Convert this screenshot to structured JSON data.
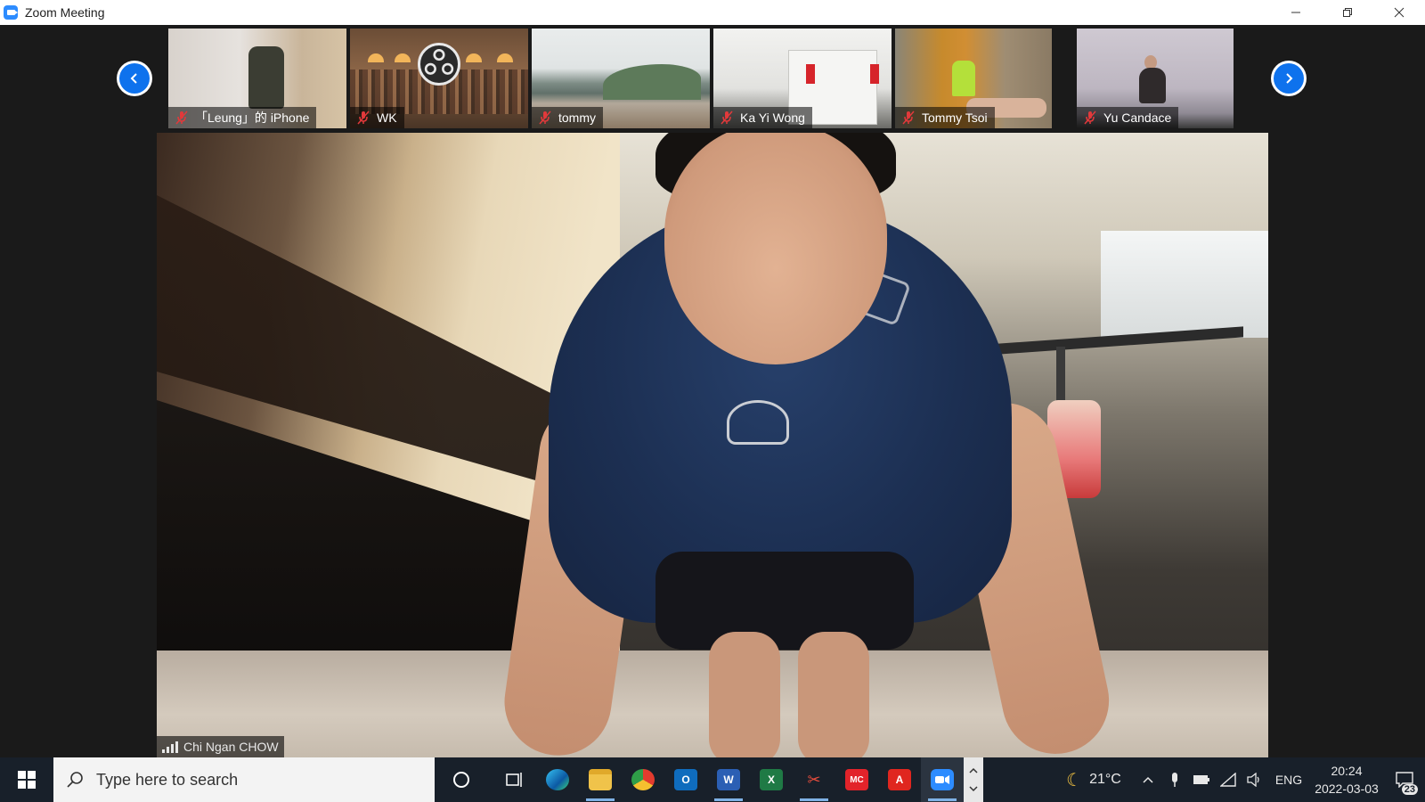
{
  "window": {
    "title": "Zoom Meeting"
  },
  "gallery": {
    "participants": [
      {
        "name": "「Leung」的 iPhone"
      },
      {
        "name": "WK"
      },
      {
        "name": "tommy"
      },
      {
        "name": "Ka Yi Wong"
      },
      {
        "name": "Tommy Tsoi"
      },
      {
        "name": "Yu Candace"
      }
    ]
  },
  "active_speaker": {
    "name": "Chi Ngan CHOW"
  },
  "taskbar": {
    "search_placeholder": "Type here to search",
    "tray": {
      "weather": "21°C",
      "language": "ENG",
      "time": "20:24",
      "date": "2022-03-03",
      "notifications": "23"
    }
  },
  "colors": {
    "zoom_blue": "#0e72ed",
    "muted_red": "#e2393b",
    "taskbar_bg": "#18202a"
  }
}
